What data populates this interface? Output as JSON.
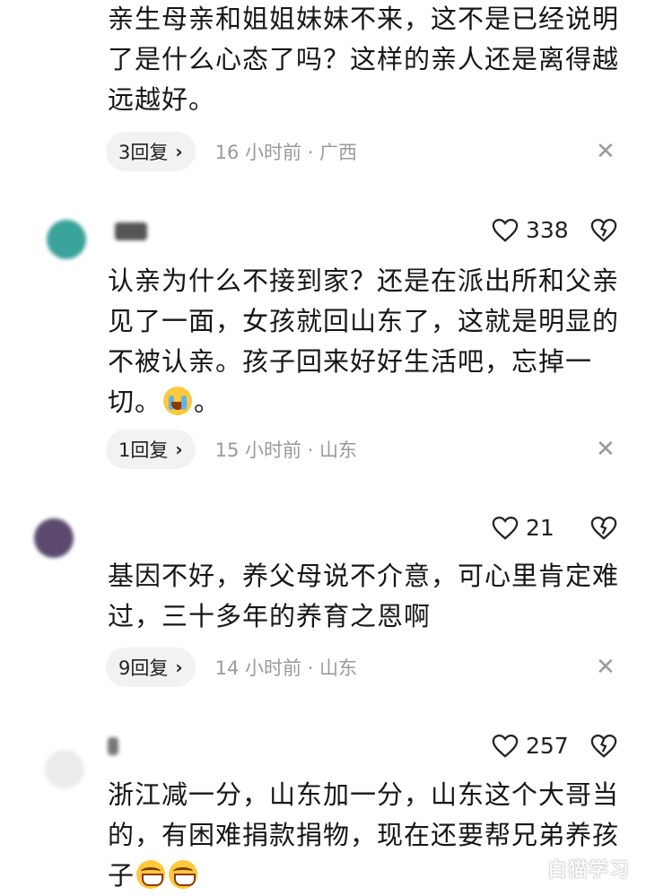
{
  "comments": [
    {
      "text": "亲生母亲和姐姐妹妹不来，这不是已经说明了是什么心态了吗？这样的亲人还是离得越远越好。",
      "reply_label": "3回复",
      "meta": "16 小时前 · 广西"
    },
    {
      "likes": "338",
      "text": "认亲为什么不接到家？还是在派出所和父亲见了一面，女孩就回山东了，这就是明显的不被认亲。孩子回来好好生活吧，忘掉一切。",
      "text_tail": "。",
      "reply_label": "1回复",
      "meta": "15 小时前 · 山东",
      "colors": {
        "avatar": "#3aa39a"
      }
    },
    {
      "likes": "21",
      "text": "基因不好，养父母说不介意，可心里肯定难过，三十多年的养育之恩啊",
      "reply_label": "9回复",
      "meta": "14 小时前 · 山东",
      "colors": {
        "avatar": "#5b4a6e"
      }
    },
    {
      "likes": "257",
      "text": "浙江减一分，山东加一分，山东这个大哥当的，有困难捐款捐物，现在还要帮兄弟养孩子",
      "colors": {
        "avatar": "#d9d9d9"
      }
    }
  ],
  "icons": {
    "like": "heart-outline-icon",
    "dislike": "broken-heart-icon",
    "close": "close-icon",
    "chevron": "chevron-right-icon"
  },
  "watermark": "白猫学习"
}
